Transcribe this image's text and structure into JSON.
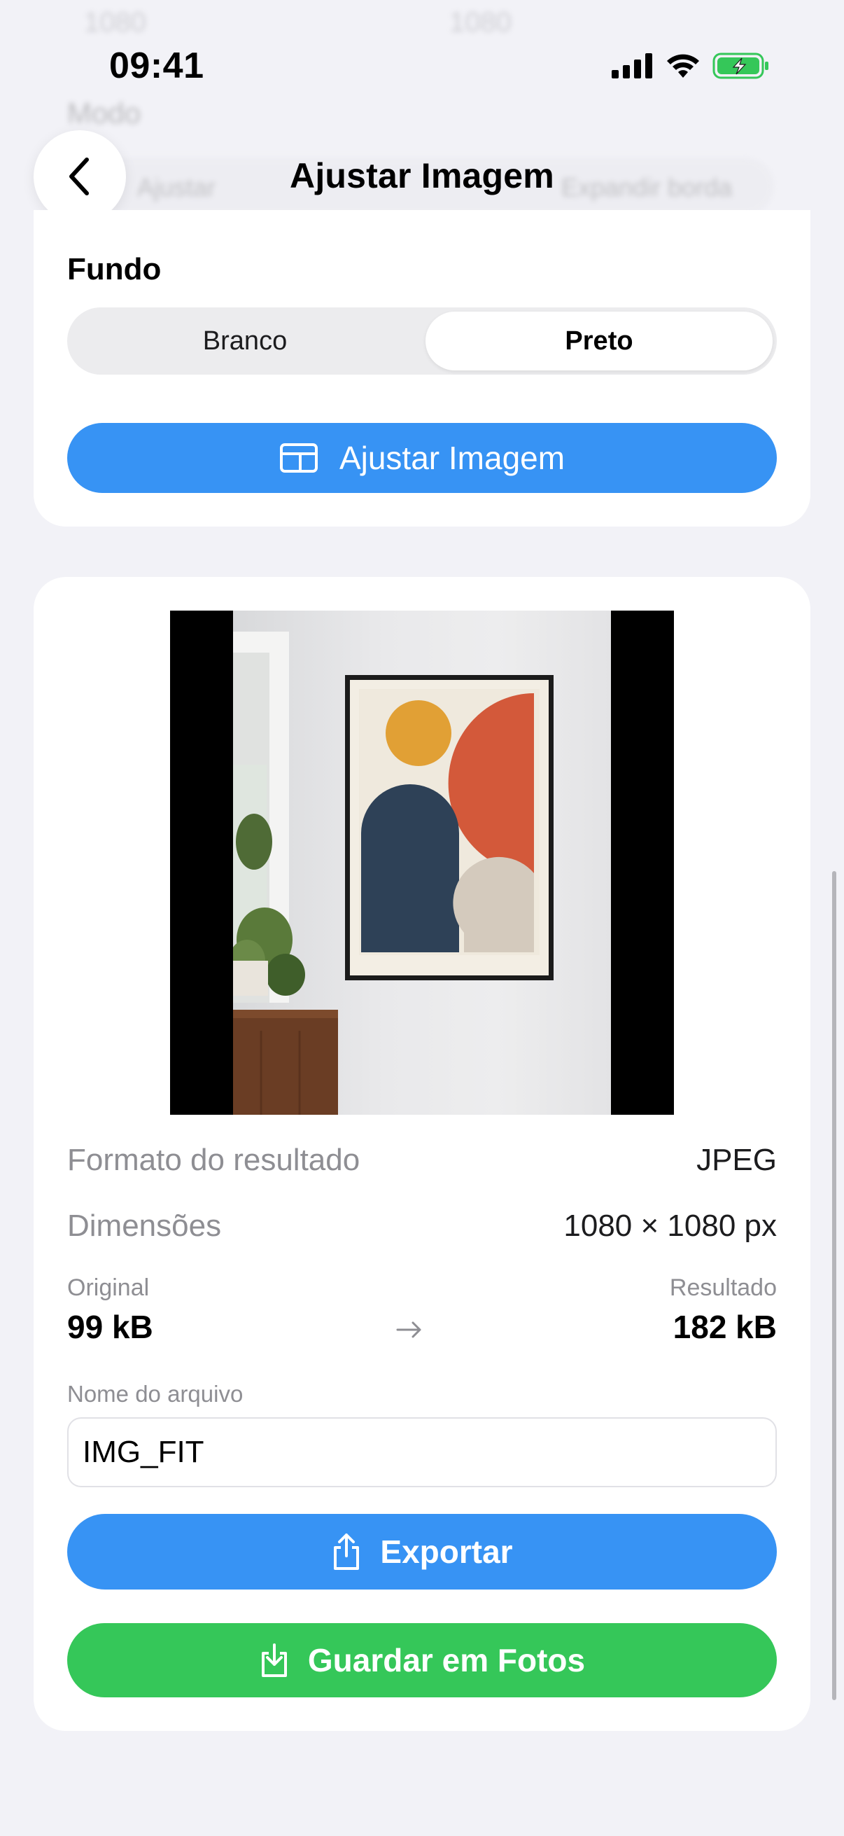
{
  "status_bar": {
    "time": "09:41"
  },
  "background_ghost": {
    "width_value": "1080",
    "height_value": "1080",
    "mode_label": "Modo",
    "mode_options": [
      "Ajustar",
      "Expandir borda"
    ]
  },
  "nav": {
    "title": "Ajustar Imagem",
    "back_icon": "chevron-left-icon"
  },
  "settings": {
    "background_label": "Fundo",
    "background_options": [
      "Branco",
      "Preto"
    ],
    "background_selected": "Preto",
    "apply_button_label": "Ajustar Imagem",
    "apply_button_icon": "fit-frame-icon"
  },
  "result": {
    "format_label": "Formato do resultado",
    "format_value": "JPEG",
    "dimensions_label": "Dimensões",
    "dimensions_value": "1080 × 1080 px",
    "original_label": "Original",
    "original_size": "99 kB",
    "result_label": "Resultado",
    "result_size": "182 kB",
    "filename_label": "Nome do arquivo",
    "filename_value": "IMG_FIT",
    "export_button_label": "Exportar",
    "save_button_label": "Guardar em Fotos"
  },
  "colors": {
    "accent_blue": "#3793f4",
    "accent_green": "#35c759",
    "background": "#f2f2f7"
  }
}
